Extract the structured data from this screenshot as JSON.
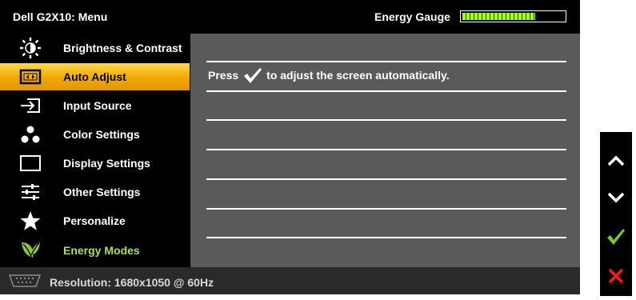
{
  "header": {
    "title": "Dell G2X10: Menu",
    "energy_gauge_label": "Energy Gauge",
    "energy_gauge_level": 0.72
  },
  "menu": {
    "items": [
      {
        "label": "Brightness & Contrast",
        "icon": "brightness-icon"
      },
      {
        "label": "Auto Adjust",
        "icon": "auto-adjust-icon",
        "selected": true
      },
      {
        "label": "Input Source",
        "icon": "input-source-icon"
      },
      {
        "label": "Color Settings",
        "icon": "color-settings-icon"
      },
      {
        "label": "Display Settings",
        "icon": "display-settings-icon"
      },
      {
        "label": "Other Settings",
        "icon": "other-settings-icon"
      },
      {
        "label": "Personalize",
        "icon": "star-icon"
      },
      {
        "label": "Energy Modes",
        "icon": "leaf-icon"
      }
    ]
  },
  "panel": {
    "press_text": "Press",
    "adjust_text": "to adjust the screen automatically."
  },
  "status": {
    "resolution": "Resolution: 1680x1050 @ 60Hz"
  },
  "side_buttons": [
    "up-arrow-icon",
    "down-arrow-icon",
    "check-icon",
    "close-icon"
  ],
  "colors": {
    "selected": "#f0a800",
    "energy_green": "#a7e05a",
    "gauge_green": "#a8ff00",
    "check_green": "#7acc1c",
    "close_red": "#ff1a1a"
  }
}
